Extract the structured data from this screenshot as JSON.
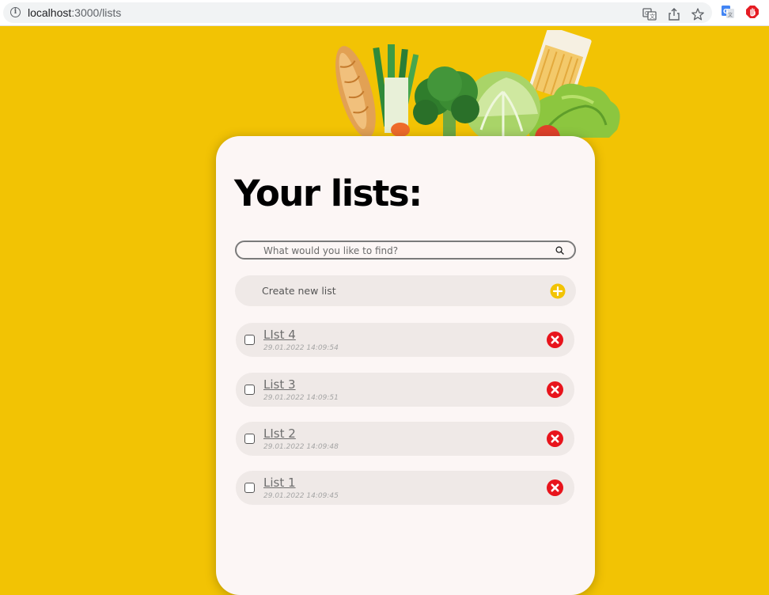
{
  "browser": {
    "url_host": "localhost",
    "url_path": ":3000/lists"
  },
  "page": {
    "title": "Your lists:",
    "search_placeholder": "What would you like to find?",
    "create_label": "Create new list"
  },
  "lists": [
    {
      "name": "LIst 4",
      "date": "29.01.2022 14:09:54"
    },
    {
      "name": "List 3",
      "date": "29.01.2022 14:09:51"
    },
    {
      "name": "LIst 2",
      "date": "29.01.2022 14:09:48"
    },
    {
      "name": "List 1",
      "date": "29.01.2022 14:09:45"
    }
  ],
  "colors": {
    "background": "#f2c304",
    "card": "#fcf6f5",
    "row": "#efe9e7",
    "add_accent": "#f2c304",
    "delete_accent": "#e8141c"
  },
  "icons": [
    "info-icon",
    "translate-icon",
    "share-icon",
    "star-icon",
    "google-translate-icon",
    "adblock-icon",
    "search-icon",
    "plus-circle-icon",
    "close-circle-icon"
  ]
}
